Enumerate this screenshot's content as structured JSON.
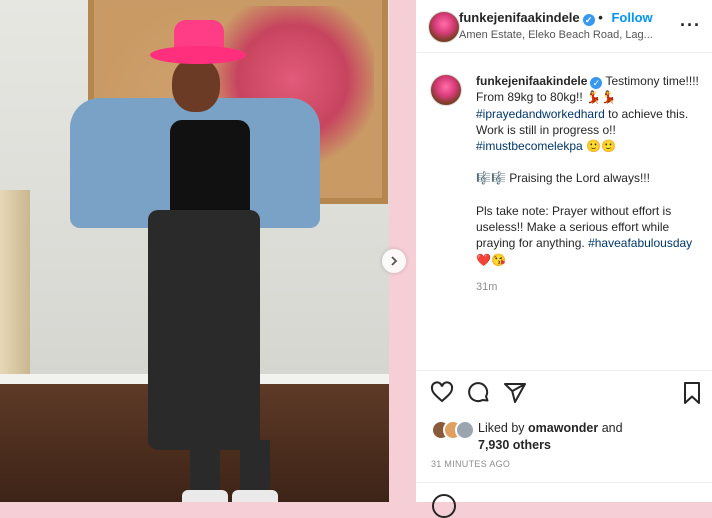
{
  "post": {
    "username": "funkejenifaakindele",
    "follow_label": "Follow",
    "location": "Amen Estate, Eleko Beach Road, Lag...",
    "more_label": "···",
    "caption_user": "funkejenifaakindele",
    "caption": {
      "p1a": "Testimony time!!!! From 89kg to 80kg!! 💃💃",
      "tag1": "#iprayedandworkedhard",
      "p1b": "to achieve this. Work is still in progress o!!",
      "tag2": "#imustbecomelekpa",
      "p1c": "🙂🙂",
      "p2": "🎼🎼 Praising the Lord always!!!",
      "p3": "Pls take note: Prayer without effort is useless!! Make a serious effort while praying for anything.",
      "tag3": "#haveafabulousday",
      "p3b": "❤️😘"
    },
    "relative_time": "31m",
    "liked_prefix": "Liked by",
    "liked_user": "omawonder",
    "liked_and": "and",
    "liked_count": "7,930 others",
    "timestamp": "31 MINUTES AGO"
  },
  "icons": [
    "heart-icon",
    "comment-icon",
    "share-icon",
    "bookmark-icon",
    "chevron-right-icon",
    "verified-icon",
    "more-icon"
  ],
  "colors": {
    "accent": "#0095f6",
    "verified": "#3897f0",
    "hashtag": "#00376b",
    "muted": "#8e8e8e",
    "backdrop": "#f6cfd6"
  }
}
